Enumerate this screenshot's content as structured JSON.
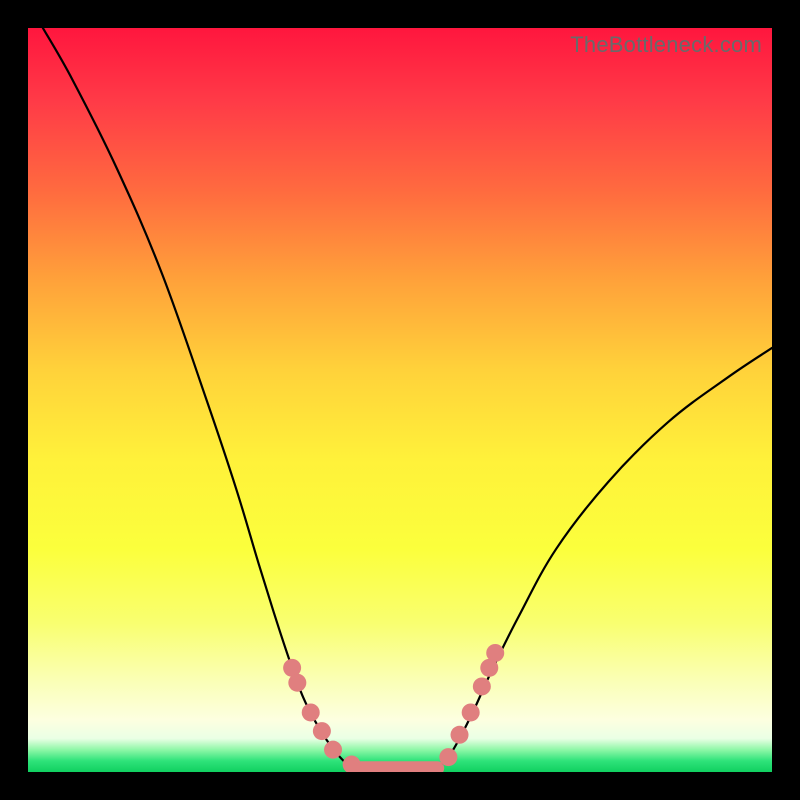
{
  "watermark": "TheBottleneck.com",
  "chart_data": {
    "type": "line",
    "title": "",
    "xlabel": "",
    "ylabel": "",
    "xlim": [
      0,
      100
    ],
    "ylim": [
      0,
      100
    ],
    "left_curve": {
      "x": [
        2,
        6,
        12,
        18,
        24,
        28,
        31,
        33.5,
        35.5,
        37,
        38.5,
        40,
        41.5,
        43,
        44.5
      ],
      "y": [
        100,
        93,
        81,
        67,
        50,
        38,
        28,
        20,
        14,
        10,
        7,
        4.5,
        2.5,
        1,
        0.5
      ]
    },
    "right_curve": {
      "x": [
        55,
        56.5,
        58,
        60,
        62.5,
        66,
        71,
        78,
        86,
        94,
        100
      ],
      "y": [
        0.5,
        2,
        4.5,
        8.5,
        14,
        21,
        30,
        39,
        47,
        53,
        57
      ]
    },
    "flat_segment": {
      "x0": 44.5,
      "x1": 55,
      "y": 0.5
    },
    "markers_left": [
      {
        "x": 35.5,
        "y": 14
      },
      {
        "x": 36.2,
        "y": 12
      },
      {
        "x": 38.0,
        "y": 8
      },
      {
        "x": 39.5,
        "y": 5.5
      },
      {
        "x": 41.0,
        "y": 3
      },
      {
        "x": 43.5,
        "y": 1
      }
    ],
    "markers_right": [
      {
        "x": 56.5,
        "y": 2
      },
      {
        "x": 58.0,
        "y": 5
      },
      {
        "x": 59.5,
        "y": 8
      },
      {
        "x": 61.0,
        "y": 11.5
      },
      {
        "x": 62.0,
        "y": 14
      },
      {
        "x": 62.8,
        "y": 16
      }
    ],
    "marker_radius": 9
  }
}
